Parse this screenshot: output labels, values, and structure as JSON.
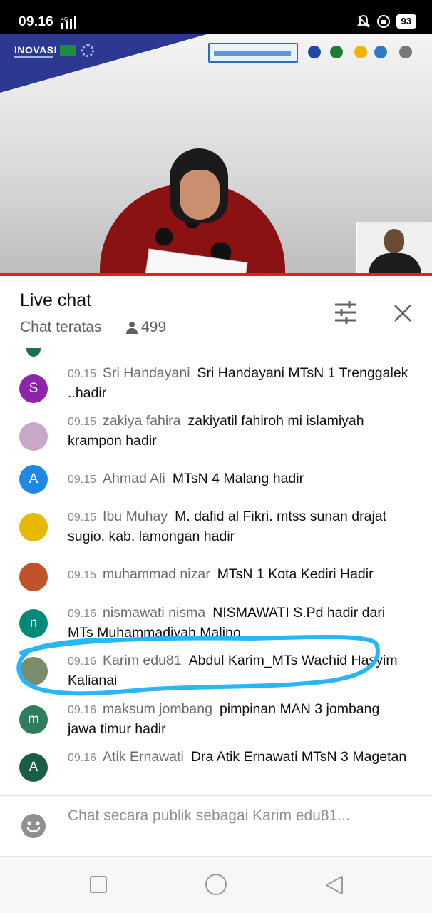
{
  "status_bar": {
    "time": "09.16",
    "network": "4G",
    "battery": "93",
    "icons": [
      "signal-icon",
      "mute-icon",
      "data-saver-icon",
      "battery-icon"
    ]
  },
  "video": {
    "logo_text": "INOVASI",
    "progress_color": "#e62117"
  },
  "chat_header": {
    "title": "Live chat",
    "subtitle": "Chat teratas",
    "viewer_count": "499",
    "icons": [
      "person-icon",
      "tune-icon",
      "close-icon"
    ]
  },
  "messages": [
    {
      "time": "09.15",
      "author": "Sri Handayani",
      "text": "Sri Handayani MTsN 1 Trenggalek ..hadir",
      "avatar_letter": "S",
      "avatar_color": "#8e24aa"
    },
    {
      "time": "09.15",
      "author": "zakiya fahira",
      "text": "zakiyatil fahiroh mi islamiyah krampon hadir",
      "avatar_letter": "",
      "avatar_color": "#c9a7c8"
    },
    {
      "time": "09.15",
      "author": "Ahmad Ali",
      "text": "MTsN 4 Malang hadir",
      "avatar_letter": "A",
      "avatar_color": "#1e88e5"
    },
    {
      "time": "09.15",
      "author": "Ibu Muhay",
      "text": "M. dafid al Fikri. mtss sunan drajat sugio. kab. lamongan hadir",
      "avatar_letter": "",
      "avatar_color": "#e6b800"
    },
    {
      "time": "09.15",
      "author": "muhammad nizar",
      "text": "MTsN 1 Kota Kediri Hadir",
      "avatar_letter": "",
      "avatar_color": "#c0532a"
    },
    {
      "time": "09.16",
      "author": "nismawati nisma",
      "text": "NISMAWATI S.Pd hadir dari MTs Muhammadiyah Malino",
      "avatar_letter": "n",
      "avatar_color": "#00897b"
    },
    {
      "time": "09.16",
      "author": "Karim edu81",
      "text": "Abdul Karim_MTs Wachid Hasyim Kalianai",
      "avatar_letter": "",
      "avatar_color": "#7a8c6a"
    },
    {
      "time": "09.16",
      "author": "maksum jombang",
      "text": "pimpinan MAN 3 jombang jawa timur hadir",
      "avatar_letter": "m",
      "avatar_color": "#2e7d5b"
    },
    {
      "time": "09.16",
      "author": "Atik Ernawati",
      "text": "Dra Atik Ernawati MTsN 3 Magetan",
      "avatar_letter": "A",
      "avatar_color": "#1b5e46"
    }
  ],
  "input": {
    "placeholder": "Chat secara publik sebagai Karim edu81..."
  },
  "annotation": {
    "highlight_color": "#29b6f6"
  }
}
